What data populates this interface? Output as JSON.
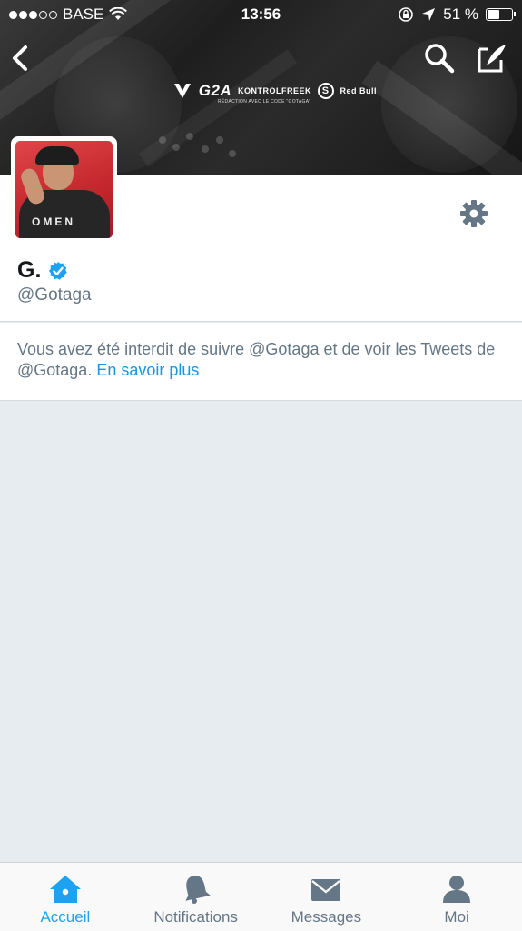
{
  "status_bar": {
    "carrier": "BASE",
    "time": "13:56",
    "battery_percent": "51 %",
    "battery_level": 0.51,
    "signal_bars_filled": 3,
    "signal_bars_total": 5
  },
  "banner": {
    "sponsors": [
      "G2A",
      "KONTROLFREEK",
      "S",
      "Red Bull"
    ],
    "sponsor_note": "RÉDACTION AVEC LE CODE \"GOTAGA\""
  },
  "profile": {
    "display_name": "G.",
    "handle": "@Gotaga",
    "avatar_shirt_text": "OMEN",
    "verified": true
  },
  "blocked_notice": {
    "text": "Vous avez été interdit de suivre @Gotaga et de voir les Tweets de @Gotaga.",
    "link_text": "En savoir plus"
  },
  "tabbar": {
    "tabs": [
      {
        "label": "Accueil",
        "icon": "home-icon",
        "active": true
      },
      {
        "label": "Notifications",
        "icon": "bell-icon",
        "active": false
      },
      {
        "label": "Messages",
        "icon": "envelope-icon",
        "active": false
      },
      {
        "label": "Moi",
        "icon": "person-icon",
        "active": false
      }
    ]
  },
  "colors": {
    "accent": "#1da1f2",
    "link": "#1b95e0",
    "muted_text": "#657786",
    "background": "#e6ecf0"
  }
}
